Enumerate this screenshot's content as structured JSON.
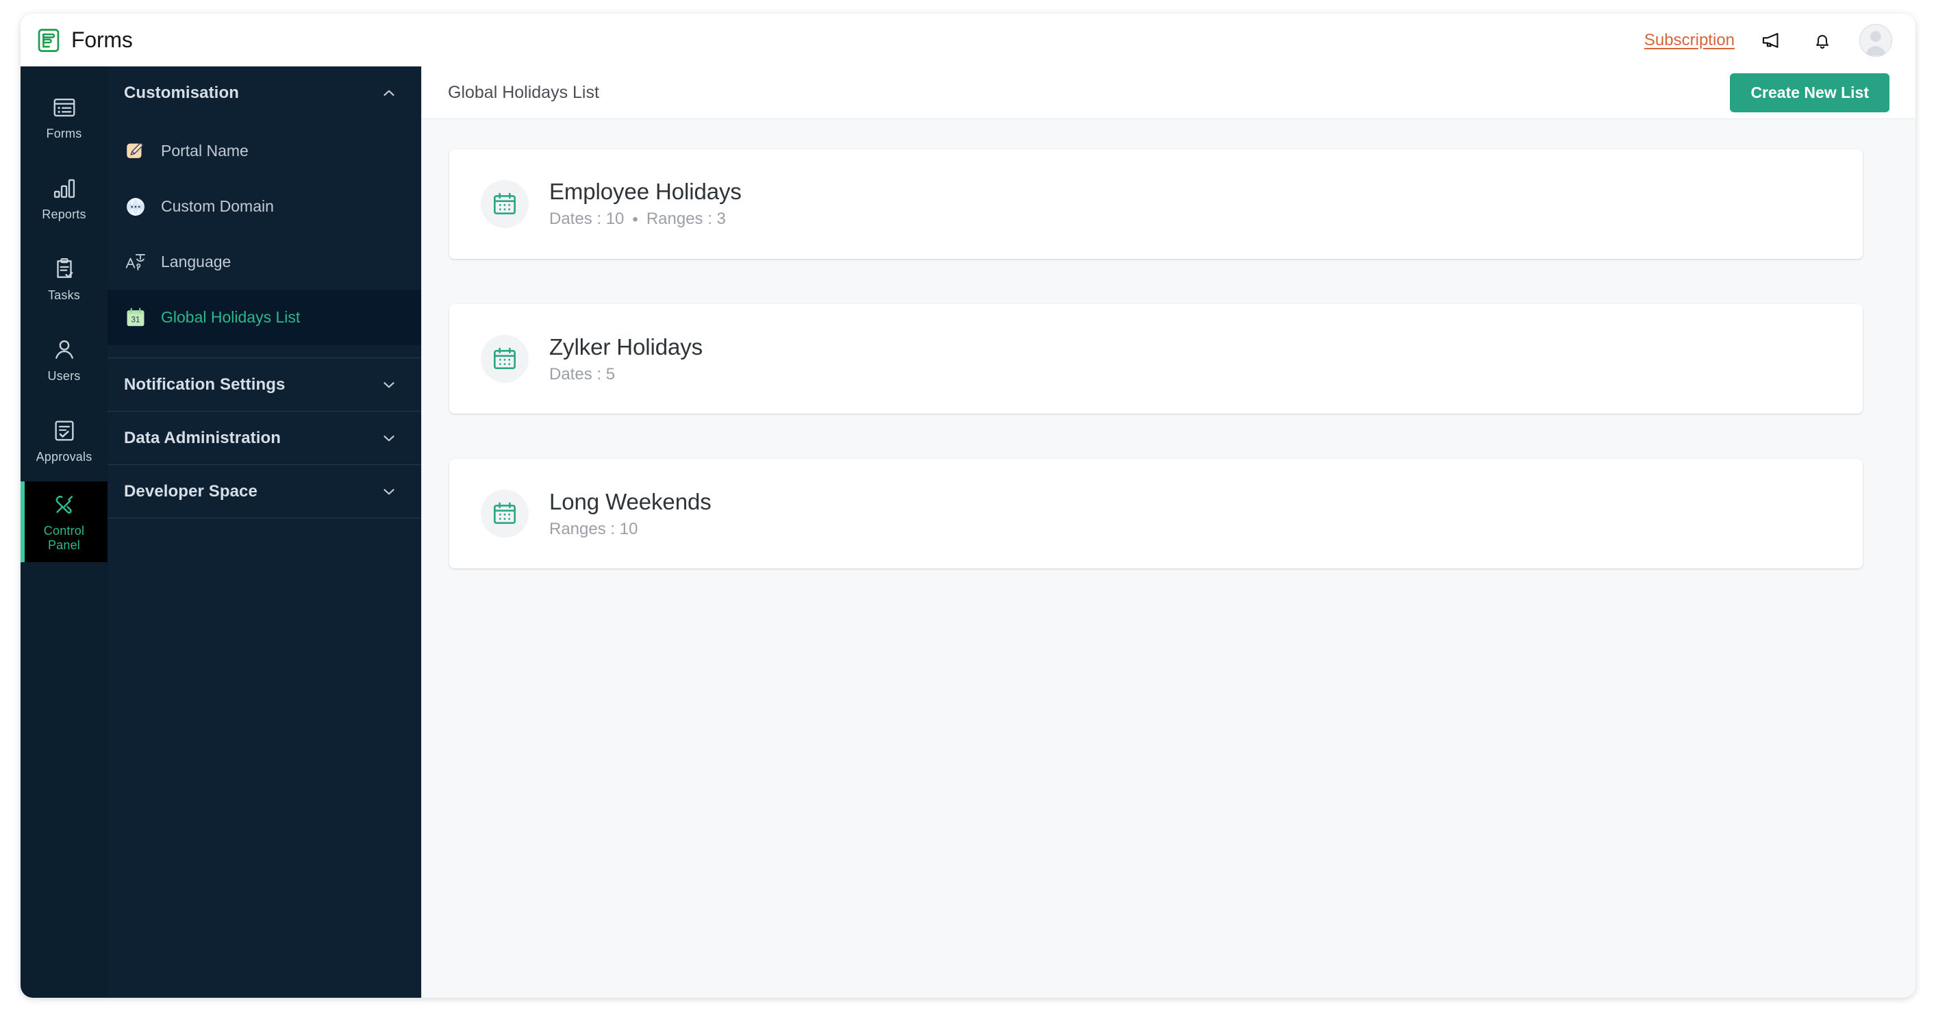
{
  "app": {
    "brand_name": "Forms",
    "brand_icon": "forms-logo-icon"
  },
  "topbar": {
    "subscription_label": "Subscription",
    "announcement_icon": "megaphone-icon",
    "notifications_icon": "bell-icon",
    "avatar_icon": "user-avatar"
  },
  "rail": {
    "items": [
      {
        "label": "Forms",
        "icon": "forms-icon",
        "active": false
      },
      {
        "label": "Reports",
        "icon": "reports-bar-chart-icon",
        "active": false
      },
      {
        "label": "Tasks",
        "icon": "tasks-clipboard-check-icon",
        "active": false
      },
      {
        "label": "Users",
        "icon": "users-person-icon",
        "active": false
      },
      {
        "label": "Approvals",
        "icon": "approvals-document-check-icon",
        "active": false
      },
      {
        "label": "Control\nPanel",
        "label_line1": "Control",
        "label_line2": "Panel",
        "icon": "control-panel-tools-icon",
        "active": true
      }
    ]
  },
  "subnav": {
    "sections": [
      {
        "title": "Customisation",
        "expanded": true,
        "chevron": "chevron-up-icon",
        "items": [
          {
            "label": "Portal Name",
            "icon": "portal-name-edit-icon",
            "active": false
          },
          {
            "label": "Custom Domain",
            "icon": "custom-domain-globe-icon",
            "active": false
          },
          {
            "label": "Language",
            "icon": "language-translate-icon",
            "active": false
          },
          {
            "label": "Global Holidays List",
            "icon": "calendar-31-icon",
            "active": true
          }
        ]
      },
      {
        "title": "Notification Settings",
        "expanded": false,
        "chevron": "chevron-down-icon",
        "items": []
      },
      {
        "title": "Data Administration",
        "expanded": false,
        "chevron": "chevron-down-icon",
        "items": []
      },
      {
        "title": "Developer Space",
        "expanded": false,
        "chevron": "chevron-down-icon",
        "items": []
      }
    ]
  },
  "main": {
    "page_title": "Global Holidays List",
    "create_button_label": "Create New List",
    "cards": [
      {
        "title": "Employee Holidays",
        "meta_left": "Dates : 10",
        "separator": "•",
        "meta_right": "Ranges : 3",
        "icon": "calendar-icon"
      },
      {
        "title": "Zylker Holidays",
        "meta_left": "Dates : 5",
        "separator": "",
        "meta_right": "",
        "icon": "calendar-icon"
      },
      {
        "title": "Long Weekends",
        "meta_left": "Ranges : 10",
        "separator": "",
        "meta_right": "",
        "icon": "calendar-icon"
      }
    ]
  },
  "colors": {
    "accent_green": "#27a383",
    "subscription_orange": "#d4663a",
    "rail_bg": "#0b1f2e",
    "subnav_bg": "#0e2133",
    "active_rail_bg": "#000000",
    "content_bg": "#f7f8f9"
  }
}
